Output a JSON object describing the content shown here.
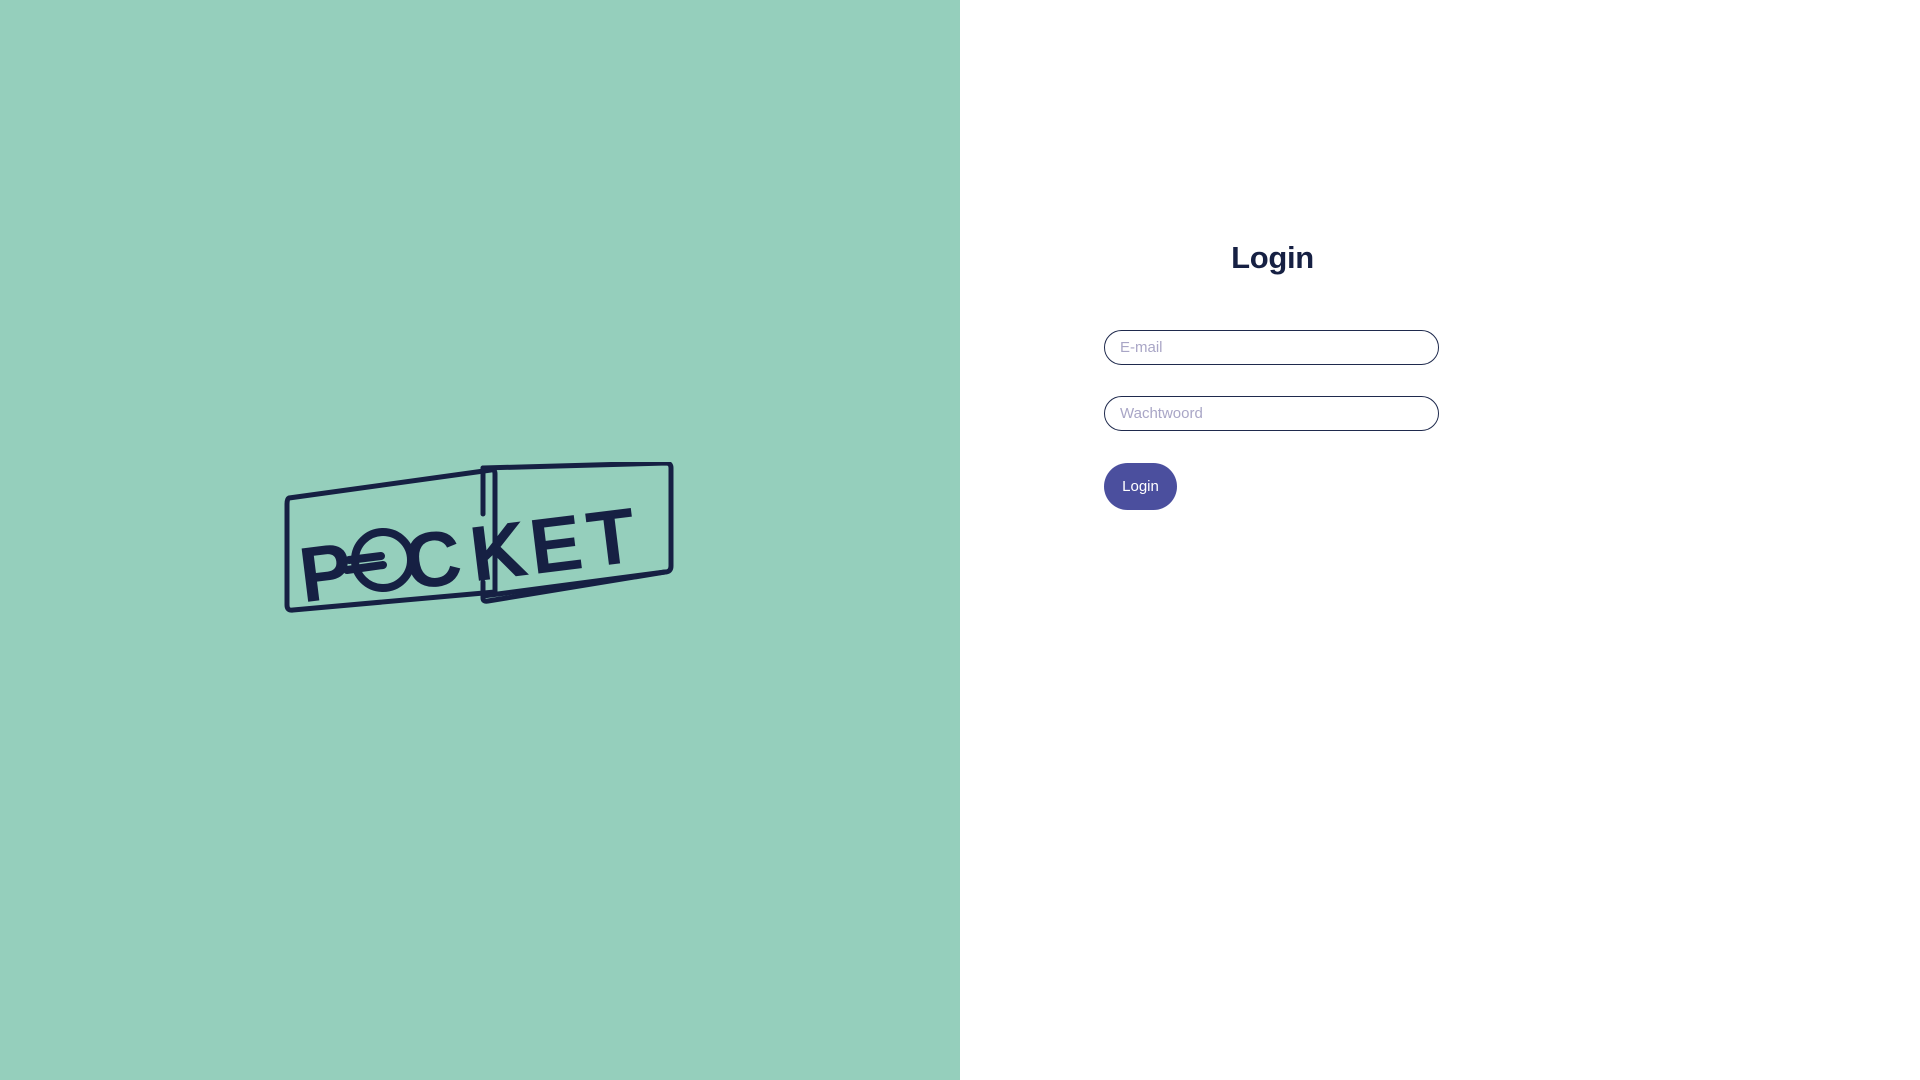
{
  "brand": {
    "logo_text": "POCKET",
    "panel_color": "#95cfbc",
    "ink_color": "#162043"
  },
  "login_form": {
    "title": "Login",
    "email_placeholder": "E-mail",
    "password_placeholder": "Wachtwoord",
    "submit_label": "Login",
    "button_color": "#4b4f9e"
  }
}
